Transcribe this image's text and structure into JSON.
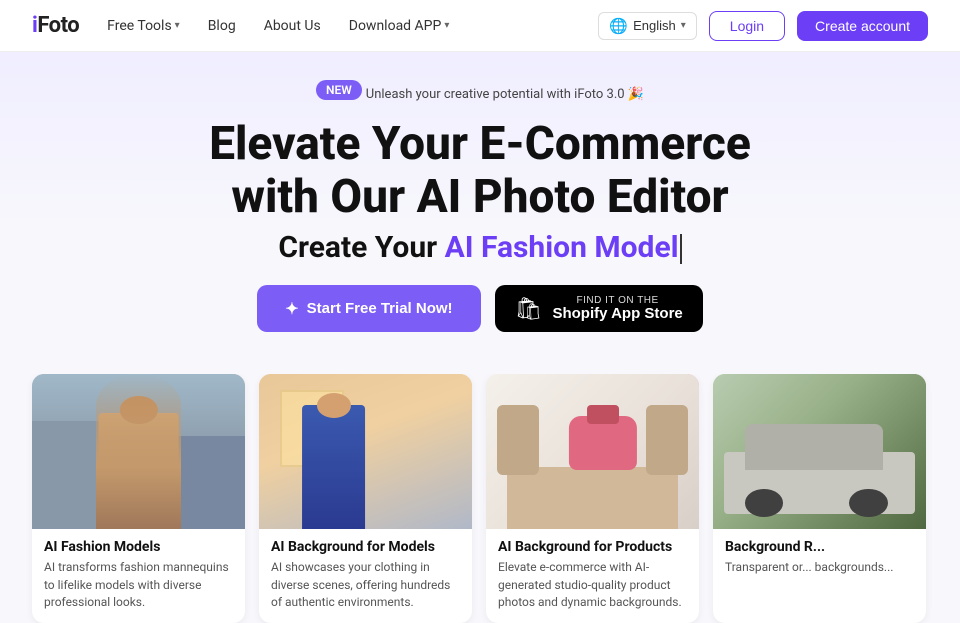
{
  "nav": {
    "logo_i": "i",
    "logo_foto": "Foto",
    "links": [
      {
        "label": "Free Tools",
        "has_dropdown": true
      },
      {
        "label": "Blog",
        "has_dropdown": false
      },
      {
        "label": "About Us",
        "has_dropdown": false
      },
      {
        "label": "Download APP",
        "has_dropdown": true
      }
    ],
    "lang": "English",
    "login": "Login",
    "create": "Create account"
  },
  "badge": {
    "tag": "NEW",
    "text": "Unleash your creative potential with iFoto 3.0 🎉"
  },
  "hero": {
    "title_line1": "Elevate Your E-Commerce",
    "title_line2": "with Our AI Photo Editor",
    "subtitle_plain": "Create Your ",
    "subtitle_highlight": "AI Fashion Model",
    "cta_primary": "Start Free Trial Now!",
    "cta_shopify_top": "FIND IT ON THE",
    "cta_shopify_main": "Shopify App Store"
  },
  "cards": [
    {
      "title": "AI Fashion Models",
      "desc": "AI transforms fashion mannequins to lifelike models with diverse professional looks.",
      "img_label": "ai-fashion-model-image"
    },
    {
      "title": "AI Background for Models",
      "desc": "AI showcases your clothing in diverse scenes, offering hundreds of authentic environments.",
      "img_label": "ai-background-models-image"
    },
    {
      "title": "AI Background for Products",
      "desc": "Elevate e-commerce with AI-generated studio-quality product photos and dynamic backgrounds.",
      "img_label": "ai-background-products-image"
    },
    {
      "title": "Background R...",
      "desc": "Transparent or... backgrounds...",
      "img_label": "background-removal-image"
    }
  ]
}
